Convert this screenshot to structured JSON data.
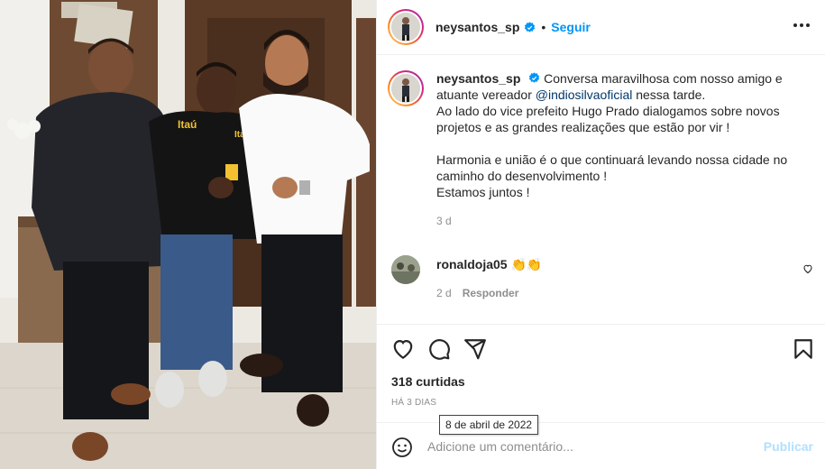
{
  "post": {
    "username": "neysantos_sp",
    "verified_icon": "verified-badge-icon",
    "dot": "•",
    "follow_label": "Seguir",
    "more_icon": "more-options-icon"
  },
  "caption": {
    "username": "neysantos_sp",
    "text_1": "Conversa maravilhosa com nosso amigo e atuante vereador",
    "mention": "@indiosilvaoficial",
    "text_2": "nessa tarde.",
    "line_3": "Ao lado do vice prefeito Hugo Prado dialogamos sobre novos projetos e as grandes realizações que estão por vir !",
    "line_4": "Harmonia e união é o que continuará levando nossa cidade no caminho do desenvolvimento !",
    "line_5": "Estamos juntos !",
    "time": "3 d"
  },
  "comment": {
    "username": "ronaldoja05",
    "text": "👏👏",
    "time": "2 d",
    "reply_label": "Responder"
  },
  "actions": {
    "likes": "318 curtidas",
    "ago": "HÁ 3 DIAS",
    "tooltip": "8 de abril de 2022"
  },
  "add_comment": {
    "placeholder": "Adicione um comentário...",
    "publish_label": "Publicar"
  },
  "colors": {
    "link": "#0095f6",
    "mention": "#00376b",
    "muted": "#8e8e8e",
    "publish_disabled": "#b2dffc"
  }
}
